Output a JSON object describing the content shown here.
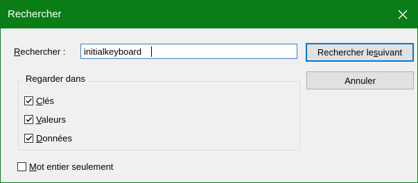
{
  "window": {
    "title": "Rechercher",
    "close_icon": "close-icon"
  },
  "search": {
    "label_prefix": "R",
    "label_rest": "echercher :",
    "value": "initialkeyboard"
  },
  "buttons": {
    "find_next_prefix": "Rechercher le ",
    "find_next_u": "s",
    "find_next_rest": "uivant",
    "cancel": "Annuler"
  },
  "look_in": {
    "legend": "Regarder dans",
    "items": [
      {
        "u": "C",
        "rest": "lés",
        "checked": true
      },
      {
        "u": "V",
        "rest": "aleurs",
        "checked": true
      },
      {
        "u": "D",
        "rest": "onnées",
        "checked": true
      }
    ]
  },
  "whole_word": {
    "u": "M",
    "rest": "ot entier seulement",
    "checked": false
  },
  "colors": {
    "titlebar": "#0a7d17",
    "accent": "#0078d7"
  }
}
